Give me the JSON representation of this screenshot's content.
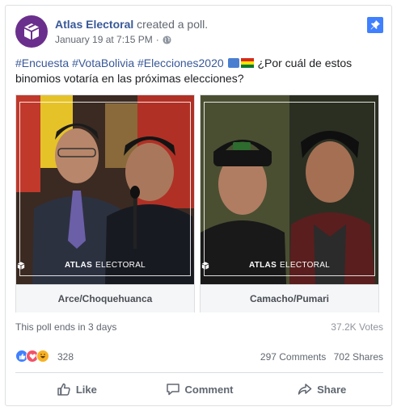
{
  "post": {
    "page_name": "Atlas Electoral",
    "action": "created a poll.",
    "timestamp": "January 19 at 7:15 PM",
    "separator": "·",
    "hashtags": [
      "#Encuesta",
      "#VotaBolivia",
      "#Elecciones2020"
    ],
    "text": "¿Por cuál de estos binomios votaría en las próximas elecciones?"
  },
  "poll": {
    "options": [
      {
        "label": "Arce/Choquehuanca",
        "watermark_bold": "ATLAS",
        "watermark_rest": "ELECTORAL"
      },
      {
        "label": "Camacho/Pumari",
        "watermark_bold": "ATLAS",
        "watermark_rest": "ELECTORAL"
      }
    ],
    "ends_text": "This poll ends in 3 days",
    "votes_text": "37.2K Votes"
  },
  "engagement": {
    "reaction_count": "328",
    "comments": "297 Comments",
    "shares": "702 Shares"
  },
  "actions": {
    "like": "Like",
    "comment": "Comment",
    "share": "Share"
  },
  "colors": {
    "brand_link": "#385898",
    "avatar_bg": "#6a2f8c",
    "pin_bg": "#4080ff"
  },
  "icons": [
    "ballot-box-logo-icon",
    "globe-icon",
    "pin-icon",
    "like-reaction-icon",
    "love-reaction-icon",
    "haha-reaction-icon",
    "thumbs-up-icon",
    "comment-icon",
    "share-icon"
  ]
}
